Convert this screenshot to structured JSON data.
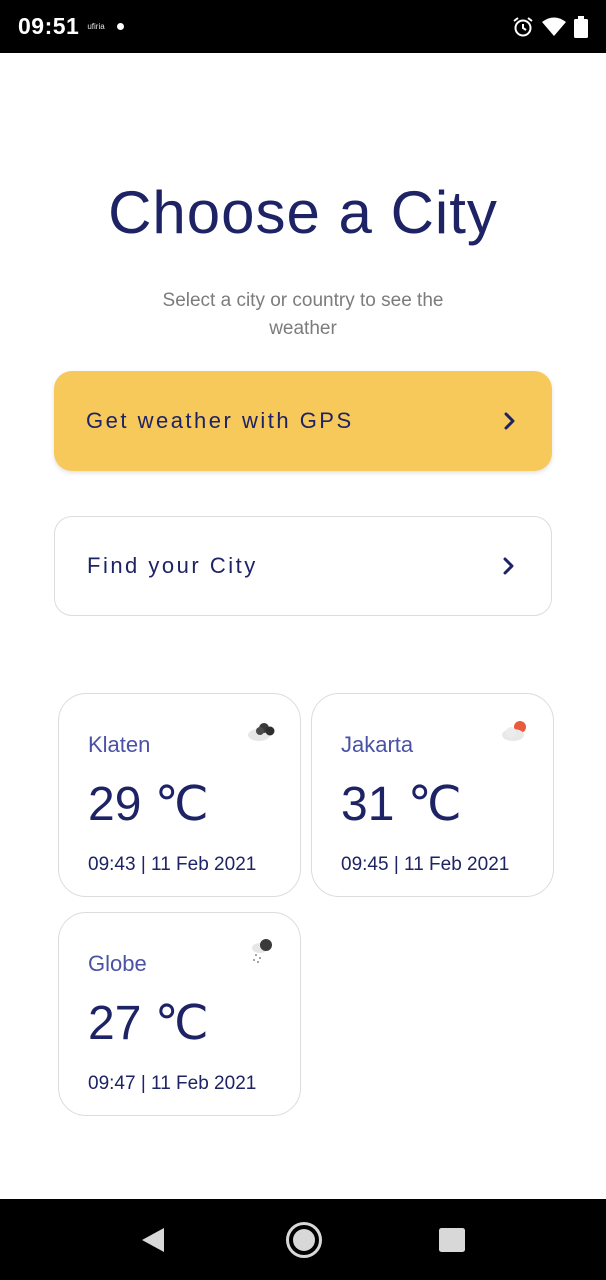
{
  "status_bar": {
    "time": "09:51",
    "carrier": "ufiria"
  },
  "header": {
    "title": "Choose a City",
    "subtitle": "Select a city or country to see the weather"
  },
  "actions": {
    "gps_label": "Get weather with GPS",
    "find_label": "Find your City"
  },
  "cities": [
    {
      "name": "Klaten",
      "temp": "29 ℃",
      "datetime": "09:43 | 11 Feb 2021",
      "icon": "cloudy-icon"
    },
    {
      "name": "Jakarta",
      "temp": "31 ℃",
      "datetime": "09:45 | 11 Feb 2021",
      "icon": "partly-sunny-icon"
    },
    {
      "name": "Globe",
      "temp": "27 ℃",
      "datetime": "09:47 | 11 Feb 2021",
      "icon": "rain-icon"
    }
  ],
  "colors": {
    "primary_text": "#1d2364",
    "accent": "#f7c85a",
    "city_name": "#4b52a6"
  }
}
